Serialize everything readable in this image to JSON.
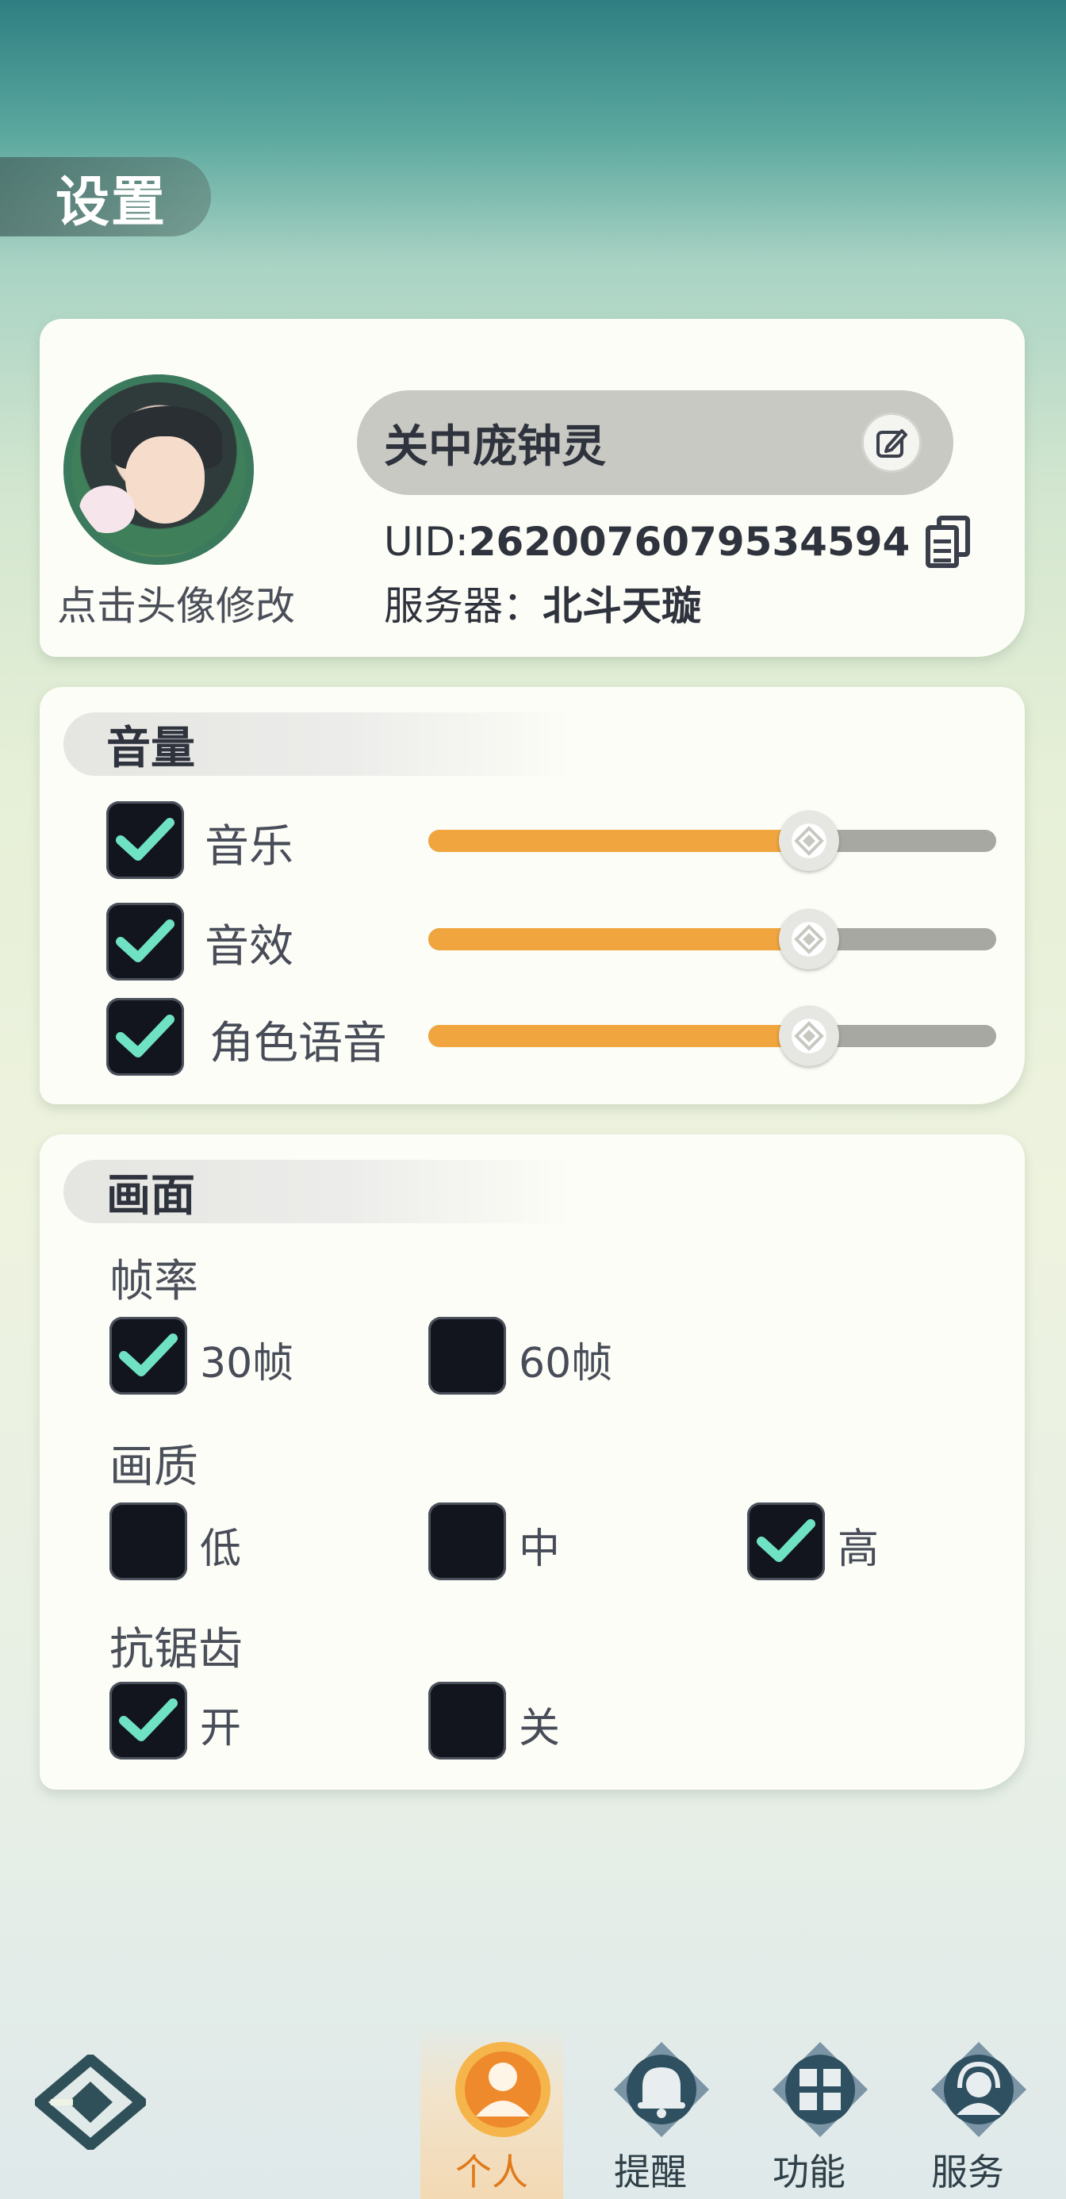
{
  "page": {
    "title": "设置"
  },
  "profile": {
    "avatar_caption": "点击头像修改",
    "nickname": "关中庞钟灵",
    "uid_label": "UID:",
    "uid_value": "2620076079534594",
    "server_label": "服务器：",
    "server_value": "北斗天璇"
  },
  "volume": {
    "header": "音量",
    "items": [
      {
        "label": "音乐",
        "checked": true,
        "level": 0.67
      },
      {
        "label": "音效",
        "checked": true,
        "level": 0.67
      },
      {
        "label": "角色语音",
        "checked": true,
        "level": 0.67
      }
    ]
  },
  "display": {
    "header": "画面",
    "framerate": {
      "label": "帧率",
      "options": [
        {
          "label": "30帧",
          "checked": true
        },
        {
          "label": "60帧",
          "checked": false
        }
      ]
    },
    "quality": {
      "label": "画质",
      "options": [
        {
          "label": "低",
          "checked": false
        },
        {
          "label": "中",
          "checked": false
        },
        {
          "label": "高",
          "checked": true
        }
      ]
    },
    "antialias": {
      "label": "抗锯齿",
      "options": [
        {
          "label": "开",
          "checked": true
        },
        {
          "label": "关",
          "checked": false
        }
      ]
    }
  },
  "nav": {
    "items": [
      {
        "label": "个人",
        "icon": "person-icon",
        "active": true
      },
      {
        "label": "提醒",
        "icon": "bell-icon",
        "active": false
      },
      {
        "label": "功能",
        "icon": "grid-icon",
        "active": false
      },
      {
        "label": "服务",
        "icon": "headset-icon",
        "active": false
      }
    ]
  },
  "colors": {
    "accent": "#f0a53e",
    "check": "#6fe2c4",
    "checkbox_bg": "#12151d",
    "card_bg": "#fcfdf6",
    "nav_active": "#e07a1a"
  }
}
